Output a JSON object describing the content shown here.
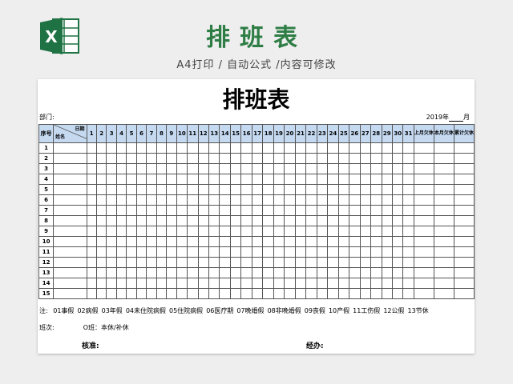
{
  "banner": {
    "title": "排班表",
    "subtitle": "A4打印 / 自动公式 /内容可修改"
  },
  "colors": {
    "banner_title": "#2e7d45",
    "header_fill": "#c5d9f1",
    "excel_green": "#1f7244"
  },
  "icons": {
    "logo": "excel-logo-icon"
  },
  "sheet": {
    "title": "排班表",
    "dept_label": "部门:",
    "year_label": "2019年",
    "month_label": "月",
    "header": {
      "index": "序号",
      "date": "日期",
      "name": "姓名",
      "days": [
        "1",
        "2",
        "3",
        "4",
        "5",
        "6",
        "7",
        "8",
        "9",
        "10",
        "11",
        "12",
        "13",
        "14",
        "15",
        "16",
        "17",
        "18",
        "19",
        "20",
        "21",
        "22",
        "23",
        "24",
        "25",
        "26",
        "27",
        "28",
        "29",
        "30",
        "31"
      ],
      "summary": [
        "上月欠休",
        "本月欠休",
        "累计欠休"
      ]
    },
    "rows": [
      "1",
      "2",
      "3",
      "4",
      "5",
      "6",
      "7",
      "8",
      "9",
      "10",
      "11",
      "12",
      "13",
      "14",
      "15"
    ],
    "notes_label": "注:",
    "notes": [
      "01事假",
      "02病假",
      "03年假",
      "04未住院病假",
      "05住院病假",
      "06医疗期",
      "07晚婚假",
      "08非晚婚假",
      "09丧假",
      "10产假",
      "11工伤假",
      "12公假",
      "13节休"
    ],
    "shift_label": "班次:",
    "shift_value": "O班：本休/补休",
    "approve_label": "核准:",
    "handler_label": "经办:"
  }
}
